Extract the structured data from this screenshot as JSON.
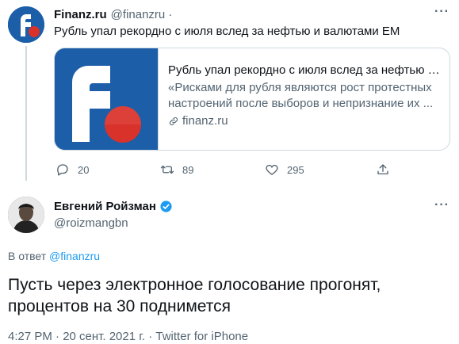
{
  "parent": {
    "name": "Finanz.ru",
    "handle": "@finanzru",
    "separator": "·",
    "more": "···",
    "text": "Рубль упал рекордно с июля вслед за нефтью и валютами EM",
    "card": {
      "title": "Рубль упал рекордно с июля вслед за нефтью и в...",
      "description": "«Рисками для рубля являются рост протестных настроений после выборов и непризнание их ...",
      "domain": "finanz.ru"
    },
    "actions": {
      "replies": "20",
      "retweets": "89",
      "likes": "295"
    }
  },
  "tweet": {
    "author_name": "Евгений Ройзман",
    "author_handle": "@roizmangbn",
    "more": "···",
    "reply_prefix": "В ответ",
    "reply_to": "@finanzru",
    "text": "Пусть через электронное голосование прогонят, процентов на 30 поднимется",
    "meta": "4:27 PM · 20 сент. 2021 г. · Twitter for iPhone"
  },
  "colors": {
    "brand_blue": "#1d5ea8",
    "brand_red": "#d9322b",
    "link": "#1d9bf0",
    "muted": "#536471",
    "verified": "#1d9bf0"
  },
  "icons": [
    "reply-icon",
    "retweet-icon",
    "like-icon",
    "share-icon",
    "link-icon",
    "verified-badge-icon"
  ]
}
